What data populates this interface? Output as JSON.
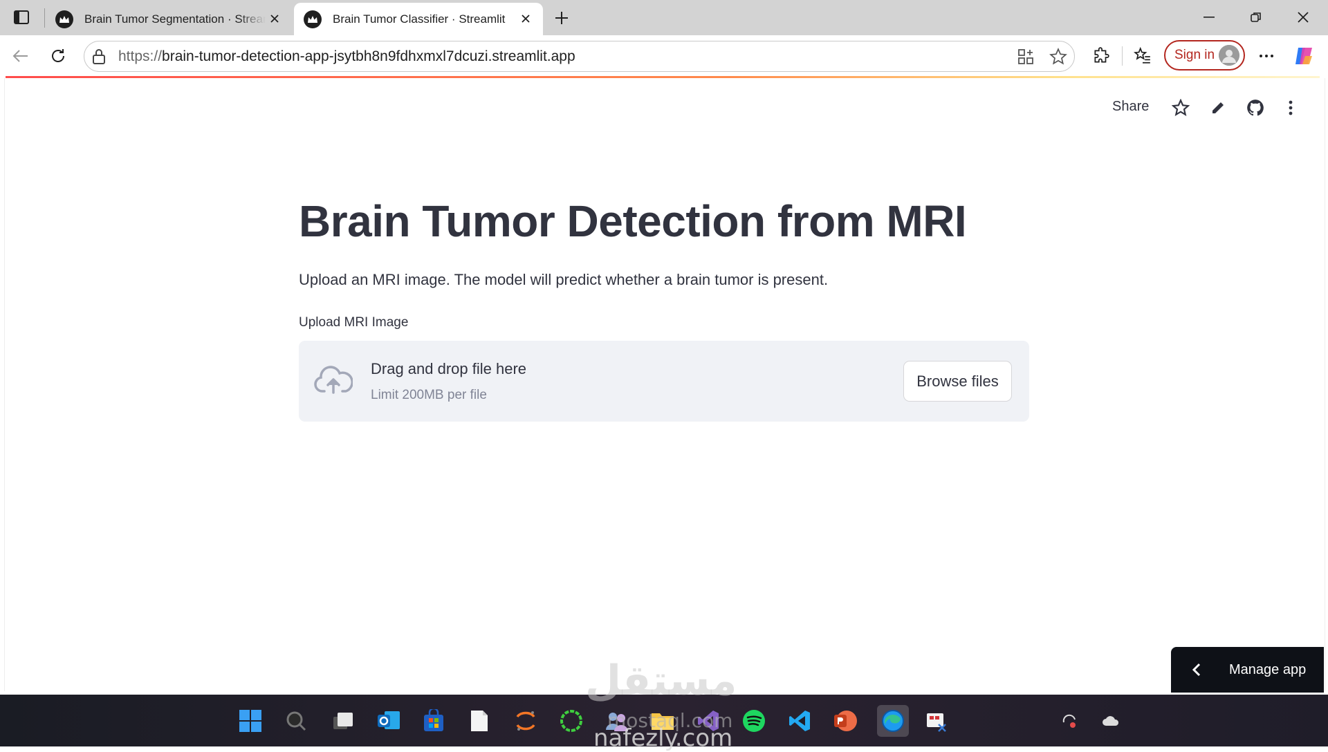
{
  "browser": {
    "tabs": [
      {
        "title": "Brain Tumor Segmentation · Streamlit",
        "active": false
      },
      {
        "title": "Brain Tumor Classifier · Streamlit",
        "active": true
      }
    ],
    "url_scheme": "https://",
    "url_host": "brain-tumor-detection-app-jsytbh8n9fdhxmxl7dcuzi.streamlit.app",
    "signin_label": "Sign in"
  },
  "app_header": {
    "share_label": "Share"
  },
  "main": {
    "title": "Brain Tumor Detection from MRI",
    "subtitle": "Upload an MRI image. The model will predict whether a brain tumor is present.",
    "uploader": {
      "label": "Upload MRI Image",
      "drag_text": "Drag and drop file here",
      "limit_text": "Limit 200MB per file",
      "browse_label": "Browse files"
    }
  },
  "manage_app_label": "Manage app",
  "watermark": {
    "arabic": "مستقل",
    "site1": "mostaql.com",
    "site2": "nafezly.com"
  },
  "colors": {
    "text": "#31333f",
    "dropzone_bg": "#f0f2f6",
    "signin_accent": "#b3261e",
    "manage_bg": "#0e1117"
  }
}
